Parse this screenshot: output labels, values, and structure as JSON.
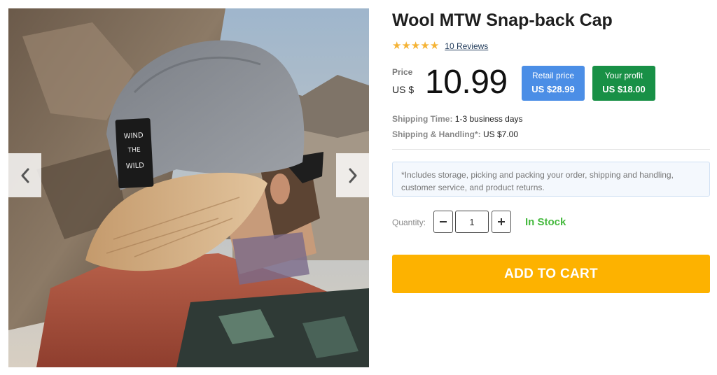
{
  "product": {
    "title": "Wool MTW Snap-back Cap",
    "rating_stars": 5,
    "reviews_link": "10 Reviews",
    "image_alt_icon": "product-photo",
    "cap_patch_text": "WIND THE WILD"
  },
  "price": {
    "label": "Price",
    "currency": "US $",
    "value": "10.99"
  },
  "retail": {
    "label": "Retail price",
    "value": "US $28.99",
    "color": "#4b8ee6"
  },
  "profit": {
    "label": "Your profit",
    "value": "US $18.00",
    "color": "#189046"
  },
  "shipping": {
    "time_label": "Shipping Time:",
    "time_value": "1-3 business days",
    "handling_label": "Shipping & Handling*:",
    "handling_value": "US $7.00"
  },
  "note": "*Includes storage, picking and packing your order, shipping and handling, customer service, and product returns.",
  "quantity": {
    "label": "Quantity:",
    "value": "1"
  },
  "stock_status": "In Stock",
  "cta": {
    "label": "ADD TO CART",
    "color": "#fdb200"
  },
  "gallery": {
    "prev_icon": "chevron-left-icon",
    "next_icon": "chevron-right-icon"
  }
}
